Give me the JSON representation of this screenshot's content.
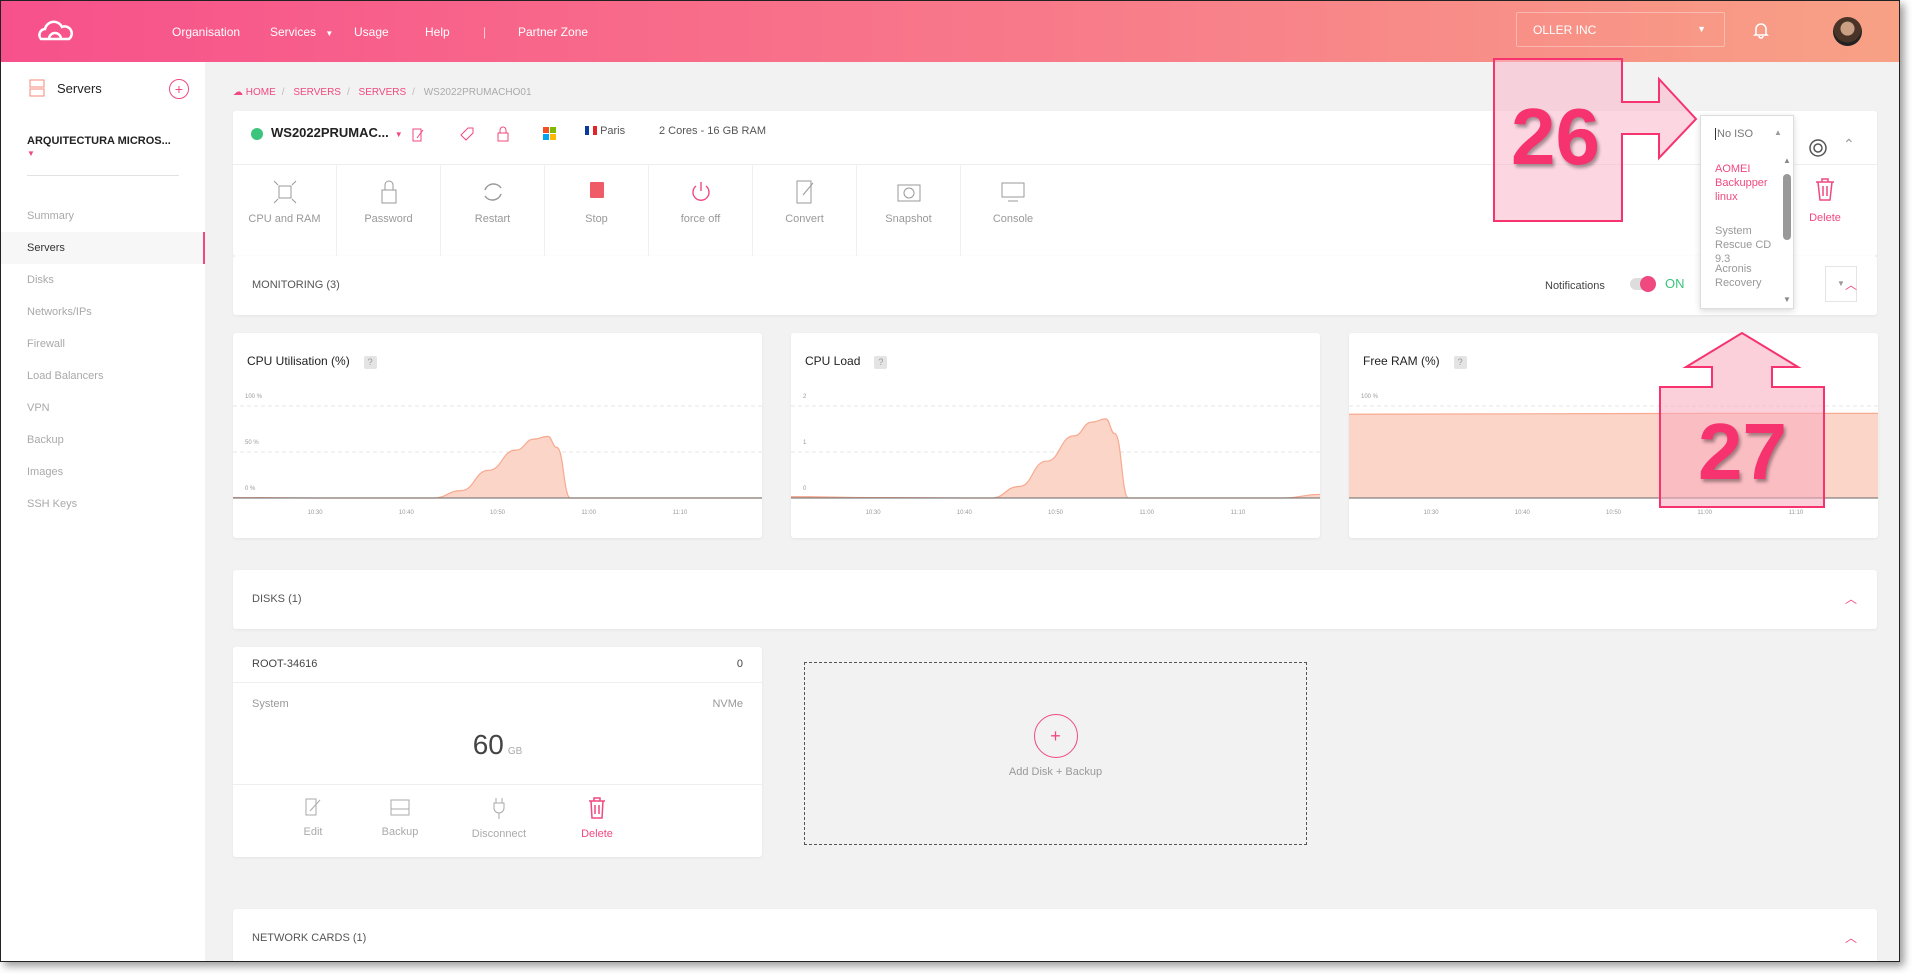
{
  "topbar": {
    "nav": [
      "Organisation",
      "Services",
      "Usage",
      "Help",
      "Partner Zone"
    ],
    "org": "OLLER INC"
  },
  "sidebar": {
    "title": "Servers",
    "project": "ARQUITECTURA MICROS...",
    "items": [
      "Summary",
      "Servers",
      "Disks",
      "Networks/IPs",
      "Firewall",
      "Load Balancers",
      "VPN",
      "Backup",
      "Images",
      "SSH Keys"
    ],
    "active": "Servers"
  },
  "breadcrumb": [
    "HOME",
    "SERVERS",
    "SERVERS",
    "WS2022PRUMACHO01"
  ],
  "server": {
    "name": "WS2022PRUMAC...",
    "status_color": "#3cc47c",
    "location": "Paris",
    "specs": "2 Cores - 16 GB RAM",
    "actions": [
      "CPU and RAM",
      "Password",
      "Restart",
      "Stop",
      "force off",
      "Convert",
      "Snapshot",
      "Console"
    ],
    "delete": "Delete",
    "iso": {
      "value": "No ISO",
      "options": [
        "AOMEI Backupper linux",
        "System Rescue CD 9.3",
        "Acronis Recovery"
      ]
    }
  },
  "monitoring": {
    "title": "MONITORING (3)",
    "notifications_label": "Notifications",
    "notifications_state": "ON"
  },
  "help_mark": "?",
  "chart_data": [
    {
      "type": "area",
      "title": "CPU Utilisation (%)",
      "yticks": [
        "100 %",
        "50 %",
        "0 %"
      ],
      "ylim": [
        0,
        100
      ],
      "xticks": [
        "10:30",
        "10:40",
        "10:50",
        "11:00",
        "11:10",
        "11:"
      ],
      "x": [
        "10:21",
        "10:30",
        "10:40",
        "10:43",
        "10:46",
        "10:49",
        "10:52",
        "10:54",
        "10:55.5",
        "10:56.5",
        "10:58",
        "11:05",
        "11:19"
      ],
      "values": [
        0.5,
        0,
        0,
        0,
        8,
        30,
        52,
        64,
        67,
        55,
        0,
        0,
        0
      ]
    },
    {
      "type": "area",
      "title": "CPU Load",
      "yticks": [
        "2",
        "1",
        "0"
      ],
      "ylim": [
        0,
        2
      ],
      "xticks": [
        "10:30",
        "10:40",
        "10:50",
        "11:00",
        "11:10",
        "11:"
      ],
      "x": [
        "10:21",
        "10:30",
        "10:40",
        "10:43",
        "10:46",
        "10:49",
        "10:52",
        "10:54",
        "10:55.5",
        "10:56.5",
        "10:58",
        "11:05",
        "11:15",
        "11:19"
      ],
      "values": [
        0.03,
        0.01,
        0,
        0,
        0.25,
        0.8,
        1.35,
        1.65,
        1.72,
        1.4,
        0,
        0,
        0,
        0.08
      ]
    },
    {
      "type": "area",
      "title": "Free RAM (%)",
      "yticks": [
        "100 %",
        "50 %",
        "0 %"
      ],
      "ylim": [
        0,
        100
      ],
      "xticks": [
        "10:30",
        "10:40",
        "10:50",
        "11:00",
        "11:10",
        "11:"
      ],
      "x": [
        "10:21",
        "11:00",
        "11:19"
      ],
      "values": [
        91,
        92,
        92
      ]
    }
  ],
  "disks": {
    "title": "DISKS (1)",
    "disk": {
      "name": "ROOT-34616",
      "index": "0",
      "type": "System",
      "bus": "NVMe",
      "size": "60",
      "unit": "GB",
      "actions": [
        "Edit",
        "Backup",
        "Disconnect",
        "Delete"
      ]
    },
    "add": "Add Disk + Backup"
  },
  "network": {
    "title": "NETWORK CARDS (1)"
  },
  "annotations": [
    "26",
    "27"
  ],
  "colors": {
    "accent": "#f0497f",
    "area_fill": "#fbd5c8",
    "area_line": "#f8a98f",
    "annotation": "#f6336f"
  }
}
